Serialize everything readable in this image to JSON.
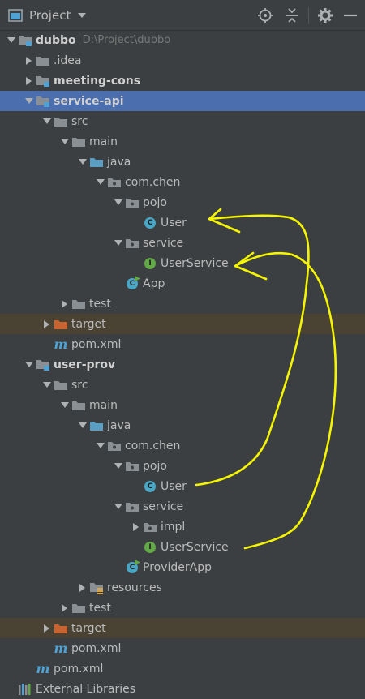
{
  "toolbar": {
    "title": "Project",
    "icons": [
      "project-view-icon",
      "dropdown-arrow-icon",
      "locate-icon",
      "collapse-all-icon",
      "settings-icon",
      "hide-icon"
    ]
  },
  "tree": [
    {
      "label": "dubbo",
      "path": "D:\\Project\\dubbo",
      "bold": true,
      "arrow": "down",
      "icon": "module-folder",
      "depth": 0
    },
    {
      "label": ".idea",
      "arrow": "right",
      "icon": "folder",
      "depth": 1
    },
    {
      "label": "meeting-cons",
      "bold": true,
      "arrow": "right",
      "icon": "module-folder",
      "depth": 1
    },
    {
      "label": "service-api",
      "bold": true,
      "arrow": "down",
      "icon": "module-folder",
      "depth": 1,
      "selected": true
    },
    {
      "label": "src",
      "arrow": "down",
      "icon": "folder",
      "depth": 2
    },
    {
      "label": "main",
      "arrow": "down",
      "icon": "folder",
      "depth": 3
    },
    {
      "label": "java",
      "arrow": "down",
      "icon": "source-folder",
      "depth": 4
    },
    {
      "label": "com.chen",
      "arrow": "down",
      "icon": "package",
      "depth": 5
    },
    {
      "label": "pojo",
      "arrow": "down",
      "icon": "package",
      "depth": 6
    },
    {
      "label": "User",
      "icon": "class",
      "depth": 7
    },
    {
      "label": "service",
      "arrow": "down",
      "icon": "package",
      "depth": 6
    },
    {
      "label": "UserService",
      "icon": "interface",
      "depth": 7
    },
    {
      "label": "App",
      "icon": "runnable-class",
      "depth": 6
    },
    {
      "label": "test",
      "arrow": "right",
      "icon": "folder",
      "depth": 3
    },
    {
      "label": "target",
      "arrow": "right",
      "icon": "excluded-folder",
      "depth": 2,
      "excluded": true
    },
    {
      "label": "pom.xml",
      "icon": "maven",
      "depth": 2
    },
    {
      "label": "user-prov",
      "bold": true,
      "arrow": "down",
      "icon": "module-folder",
      "depth": 1
    },
    {
      "label": "src",
      "arrow": "down",
      "icon": "folder",
      "depth": 2
    },
    {
      "label": "main",
      "arrow": "down",
      "icon": "folder",
      "depth": 3
    },
    {
      "label": "java",
      "arrow": "down",
      "icon": "source-folder",
      "depth": 4
    },
    {
      "label": "com.chen",
      "arrow": "down",
      "icon": "package",
      "depth": 5
    },
    {
      "label": "pojo",
      "arrow": "down",
      "icon": "package",
      "depth": 6
    },
    {
      "label": "User",
      "icon": "class",
      "depth": 7
    },
    {
      "label": "service",
      "arrow": "down",
      "icon": "package",
      "depth": 6
    },
    {
      "label": "impl",
      "arrow": "right",
      "icon": "package",
      "depth": 7
    },
    {
      "label": "UserService",
      "icon": "interface",
      "depth": 7
    },
    {
      "label": "ProviderApp",
      "icon": "runnable-class",
      "depth": 6
    },
    {
      "label": "resources",
      "arrow": "right",
      "icon": "resources-folder",
      "depth": 4
    },
    {
      "label": "test",
      "arrow": "right",
      "icon": "folder",
      "depth": 3
    },
    {
      "label": "target",
      "arrow": "right",
      "icon": "excluded-folder",
      "depth": 2,
      "excluded": true
    },
    {
      "label": "pom.xml",
      "icon": "maven",
      "depth": 2
    },
    {
      "label": "pom.xml",
      "icon": "maven",
      "depth": 1
    },
    {
      "label": "External Libraries",
      "icon": "library",
      "depth": 0
    }
  ],
  "colors": {
    "background": "#3c3f41",
    "selection": "#4b6eaf",
    "excluded_row": "#4a4233",
    "text": "#bbbbbb",
    "folder": "#8a8f93",
    "source_folder": "#5a9fc3",
    "excluded_folder": "#c86432",
    "class_icon": "#49a6c5",
    "interface_icon": "#62a847",
    "annotation": "#ffff00"
  }
}
